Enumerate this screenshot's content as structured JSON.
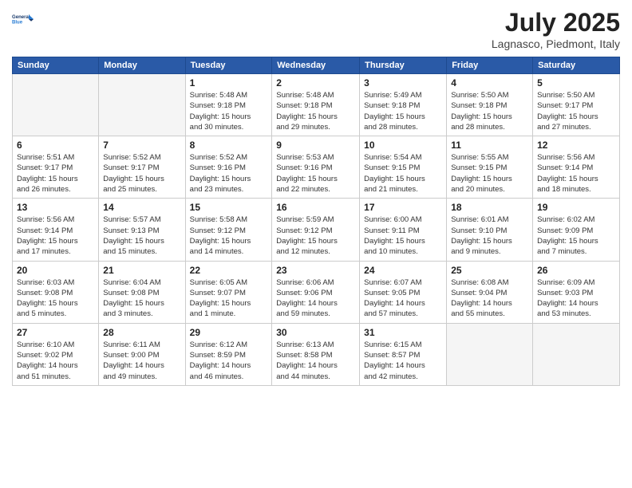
{
  "header": {
    "logo_line1": "General",
    "logo_line2": "Blue",
    "month_title": "July 2025",
    "location": "Lagnasco, Piedmont, Italy"
  },
  "weekdays": [
    "Sunday",
    "Monday",
    "Tuesday",
    "Wednesday",
    "Thursday",
    "Friday",
    "Saturday"
  ],
  "weeks": [
    [
      {
        "day": "",
        "info": ""
      },
      {
        "day": "",
        "info": ""
      },
      {
        "day": "1",
        "info": "Sunrise: 5:48 AM\nSunset: 9:18 PM\nDaylight: 15 hours\nand 30 minutes."
      },
      {
        "day": "2",
        "info": "Sunrise: 5:48 AM\nSunset: 9:18 PM\nDaylight: 15 hours\nand 29 minutes."
      },
      {
        "day": "3",
        "info": "Sunrise: 5:49 AM\nSunset: 9:18 PM\nDaylight: 15 hours\nand 28 minutes."
      },
      {
        "day": "4",
        "info": "Sunrise: 5:50 AM\nSunset: 9:18 PM\nDaylight: 15 hours\nand 28 minutes."
      },
      {
        "day": "5",
        "info": "Sunrise: 5:50 AM\nSunset: 9:17 PM\nDaylight: 15 hours\nand 27 minutes."
      }
    ],
    [
      {
        "day": "6",
        "info": "Sunrise: 5:51 AM\nSunset: 9:17 PM\nDaylight: 15 hours\nand 26 minutes."
      },
      {
        "day": "7",
        "info": "Sunrise: 5:52 AM\nSunset: 9:17 PM\nDaylight: 15 hours\nand 25 minutes."
      },
      {
        "day": "8",
        "info": "Sunrise: 5:52 AM\nSunset: 9:16 PM\nDaylight: 15 hours\nand 23 minutes."
      },
      {
        "day": "9",
        "info": "Sunrise: 5:53 AM\nSunset: 9:16 PM\nDaylight: 15 hours\nand 22 minutes."
      },
      {
        "day": "10",
        "info": "Sunrise: 5:54 AM\nSunset: 9:15 PM\nDaylight: 15 hours\nand 21 minutes."
      },
      {
        "day": "11",
        "info": "Sunrise: 5:55 AM\nSunset: 9:15 PM\nDaylight: 15 hours\nand 20 minutes."
      },
      {
        "day": "12",
        "info": "Sunrise: 5:56 AM\nSunset: 9:14 PM\nDaylight: 15 hours\nand 18 minutes."
      }
    ],
    [
      {
        "day": "13",
        "info": "Sunrise: 5:56 AM\nSunset: 9:14 PM\nDaylight: 15 hours\nand 17 minutes."
      },
      {
        "day": "14",
        "info": "Sunrise: 5:57 AM\nSunset: 9:13 PM\nDaylight: 15 hours\nand 15 minutes."
      },
      {
        "day": "15",
        "info": "Sunrise: 5:58 AM\nSunset: 9:12 PM\nDaylight: 15 hours\nand 14 minutes."
      },
      {
        "day": "16",
        "info": "Sunrise: 5:59 AM\nSunset: 9:12 PM\nDaylight: 15 hours\nand 12 minutes."
      },
      {
        "day": "17",
        "info": "Sunrise: 6:00 AM\nSunset: 9:11 PM\nDaylight: 15 hours\nand 10 minutes."
      },
      {
        "day": "18",
        "info": "Sunrise: 6:01 AM\nSunset: 9:10 PM\nDaylight: 15 hours\nand 9 minutes."
      },
      {
        "day": "19",
        "info": "Sunrise: 6:02 AM\nSunset: 9:09 PM\nDaylight: 15 hours\nand 7 minutes."
      }
    ],
    [
      {
        "day": "20",
        "info": "Sunrise: 6:03 AM\nSunset: 9:08 PM\nDaylight: 15 hours\nand 5 minutes."
      },
      {
        "day": "21",
        "info": "Sunrise: 6:04 AM\nSunset: 9:08 PM\nDaylight: 15 hours\nand 3 minutes."
      },
      {
        "day": "22",
        "info": "Sunrise: 6:05 AM\nSunset: 9:07 PM\nDaylight: 15 hours\nand 1 minute."
      },
      {
        "day": "23",
        "info": "Sunrise: 6:06 AM\nSunset: 9:06 PM\nDaylight: 14 hours\nand 59 minutes."
      },
      {
        "day": "24",
        "info": "Sunrise: 6:07 AM\nSunset: 9:05 PM\nDaylight: 14 hours\nand 57 minutes."
      },
      {
        "day": "25",
        "info": "Sunrise: 6:08 AM\nSunset: 9:04 PM\nDaylight: 14 hours\nand 55 minutes."
      },
      {
        "day": "26",
        "info": "Sunrise: 6:09 AM\nSunset: 9:03 PM\nDaylight: 14 hours\nand 53 minutes."
      }
    ],
    [
      {
        "day": "27",
        "info": "Sunrise: 6:10 AM\nSunset: 9:02 PM\nDaylight: 14 hours\nand 51 minutes."
      },
      {
        "day": "28",
        "info": "Sunrise: 6:11 AM\nSunset: 9:00 PM\nDaylight: 14 hours\nand 49 minutes."
      },
      {
        "day": "29",
        "info": "Sunrise: 6:12 AM\nSunset: 8:59 PM\nDaylight: 14 hours\nand 46 minutes."
      },
      {
        "day": "30",
        "info": "Sunrise: 6:13 AM\nSunset: 8:58 PM\nDaylight: 14 hours\nand 44 minutes."
      },
      {
        "day": "31",
        "info": "Sunrise: 6:15 AM\nSunset: 8:57 PM\nDaylight: 14 hours\nand 42 minutes."
      },
      {
        "day": "",
        "info": ""
      },
      {
        "day": "",
        "info": ""
      }
    ]
  ]
}
